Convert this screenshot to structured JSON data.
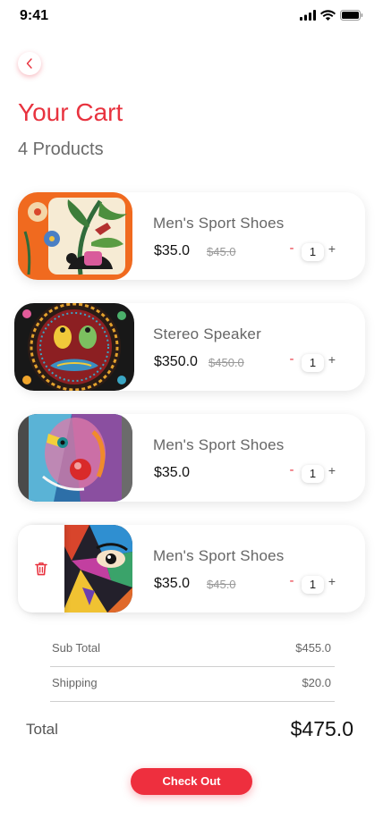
{
  "status_bar": {
    "time": "9:41"
  },
  "header": {
    "title": "Your Cart",
    "subtitle": "4 Products"
  },
  "cart_items": [
    {
      "name": "Men's Sport Shoes",
      "price": "$35.0",
      "old_price": "$45.0",
      "quantity": "1",
      "image": "floral-folk-art-painting"
    },
    {
      "name": "Stereo Speaker",
      "price": "$350.0",
      "old_price": "$450.0",
      "quantity": "1",
      "image": "circular-bird-mandala-painting"
    },
    {
      "name": "Men's Sport Shoes",
      "price": "$35.0",
      "old_price": "",
      "quantity": "1",
      "image": "colorful-face-graffiti"
    },
    {
      "name": "Men's Sport Shoes",
      "price": "$35.0",
      "old_price": "$45.0",
      "quantity": "1",
      "image": "abstract-eye-mural",
      "swiped": true
    }
  ],
  "qty_controls": {
    "minus": "-",
    "plus": "+"
  },
  "summary": {
    "subtotal_label": "Sub Total",
    "subtotal_value": "$455.0",
    "shipping_label": "Shipping",
    "shipping_value": "$20.0",
    "total_label": "Total",
    "total_value": "$475.0"
  },
  "checkout": {
    "label": "Check Out"
  },
  "colors": {
    "accent": "#e8333f",
    "button": "#ee2f3e"
  },
  "icons": [
    "back-chevron-icon",
    "trash-icon",
    "signal-icon",
    "wifi-icon",
    "battery-icon"
  ]
}
